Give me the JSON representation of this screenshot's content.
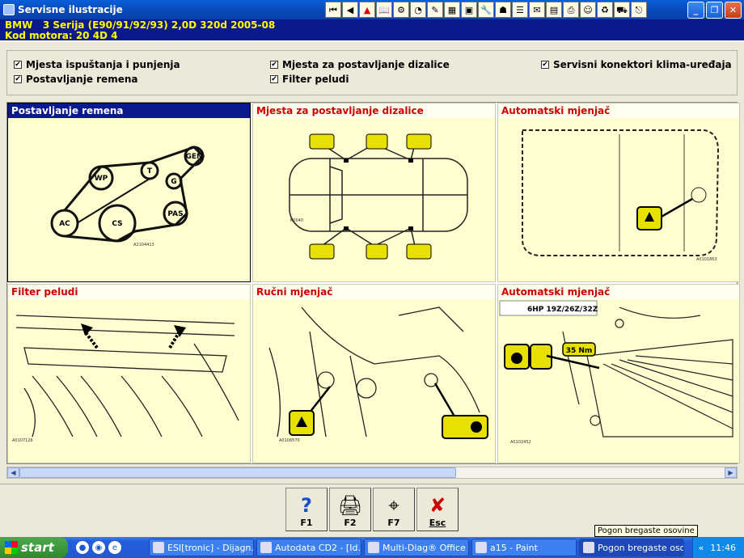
{
  "window": {
    "title": "Servisne ilustracije"
  },
  "toolbar": {
    "icons": [
      "first-icon",
      "prev-icon",
      "warning-icon",
      "book-icon",
      "gear-icon",
      "clock-icon",
      "tools-icon",
      "grid-icon",
      "save-icon",
      "wrench-icon",
      "rescue-icon",
      "list-icon",
      "note-icon",
      "calendar-icon",
      "printer-icon",
      "user-icon",
      "recycle-icon",
      "car-icon",
      "exit-icon"
    ]
  },
  "header": {
    "line1": "BMW   3 Serija (E90/91/92/93) 2,0D 320d 2005-08",
    "line2": "Kod motora: 20 4D 4"
  },
  "options": [
    {
      "label": "Mjesta ispuštanja i punjenja",
      "checked": true
    },
    {
      "label": "Postavljanje remena",
      "checked": true
    },
    {
      "label": "Mjesta za postavljanje dizalice",
      "checked": true
    },
    {
      "label": "Filter peludi",
      "checked": true
    },
    {
      "label": "Servisni konektori klima-uređaja",
      "checked": true
    }
  ],
  "cells": [
    {
      "title": "Postavljanje remena",
      "selected": true
    },
    {
      "title": "Mjesta za postavljanje dizalice"
    },
    {
      "title": "Automatski mjenjač"
    },
    {
      "title": "Filter peludi"
    },
    {
      "title": "Ručni mjenjač"
    },
    {
      "title": "Automatski mjenjač"
    }
  ],
  "belt": {
    "pulleys": [
      "GEN",
      "WP",
      "T",
      "G",
      "AC",
      "CS",
      "PAS"
    ],
    "code": "A2104413"
  },
  "jack": {
    "code": "K0040"
  },
  "auto1": {
    "code": "A0101863"
  },
  "filter": {
    "code": "A0107126"
  },
  "manual": {
    "code": "A0106570"
  },
  "auto2": {
    "spec": "6HP 19Z/26Z/32Z",
    "torque": "35 Nm",
    "code": "A0102452"
  },
  "fkeys": [
    {
      "key": "F1",
      "icon": "?"
    },
    {
      "key": "F2",
      "icon": "🖨"
    },
    {
      "key": "F7",
      "icon": "⌖"
    },
    {
      "key": "Esc",
      "icon": "✘"
    }
  ],
  "tooltip": "Pogon bregaste osovine",
  "taskbar": {
    "start": "start",
    "tasks": [
      "ESI[tronic] - Dijagn...",
      "Autodata CD2 - [Id...",
      "Multi-Diag® Office ...",
      "a15 - Paint",
      "Pogon bregaste oso..."
    ],
    "clock": "11:46"
  }
}
